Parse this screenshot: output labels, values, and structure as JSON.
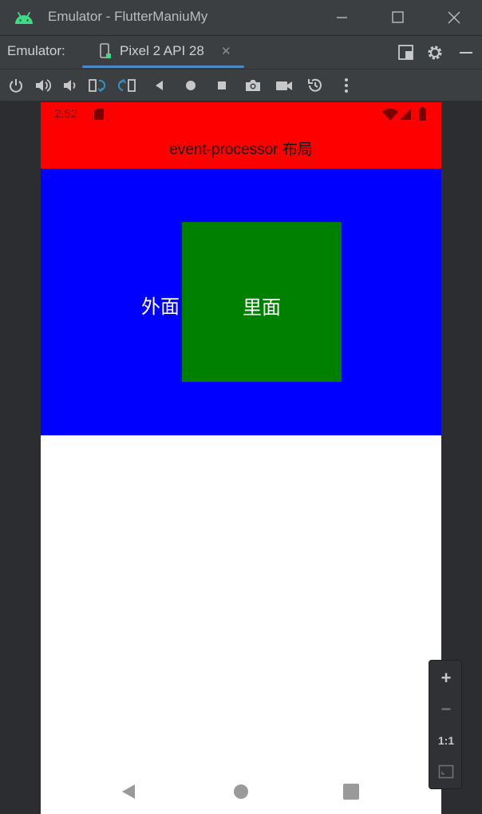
{
  "window": {
    "title": "Emulator - FlutterManiuMy"
  },
  "tabbar": {
    "emulator_label": "Emulator:",
    "device_tab": "Pixel 2 API 28",
    "close_glyph": "✕"
  },
  "device": {
    "status_time": "2:52",
    "app_title": "event-processor 布局",
    "outer_label": "外面",
    "inner_label": "里面"
  },
  "zoom": {
    "plus": "+",
    "minus": "−",
    "one_to_one": "1:1"
  },
  "colors": {
    "status_and_appbar": "#ff0000",
    "outer_container": "#0000ff",
    "inner_container": "#008000",
    "ide_background": "#2b2d30"
  }
}
